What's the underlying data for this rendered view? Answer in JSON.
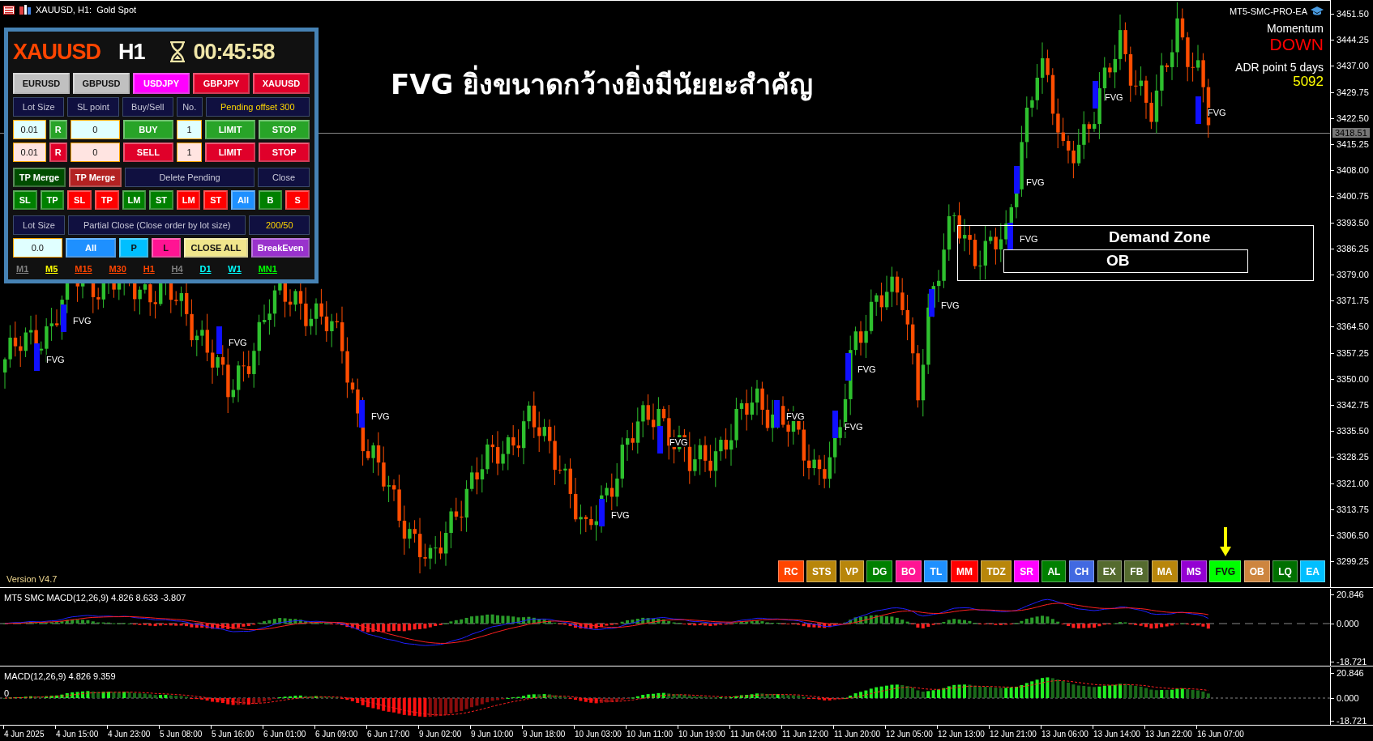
{
  "title_bar": {
    "text": "XAUUSD, H1:  Gold Spot"
  },
  "panel": {
    "symbol": "XAUUSD",
    "timeframe": "H1",
    "countdown": "00:45:58",
    "groups": [
      {
        "items": [
          {
            "kind": "button",
            "text": "EURUSD",
            "color": "#c0c0c0",
            "dark_text": true
          },
          {
            "kind": "button",
            "text": "GBPUSD",
            "color": "#c0c0c0",
            "dark_text": true
          },
          {
            "kind": "button",
            "text": "USDJPY",
            "color": "#ff00ff",
            "dark_text": false
          },
          {
            "kind": "button",
            "text": "GBPJPY",
            "color": "#e0002a",
            "dark_text": false
          },
          {
            "kind": "button",
            "text": "XAUUSD",
            "color": "#e0002a",
            "dark_text": false
          }
        ]
      },
      {
        "items": [
          {
            "kind": "header",
            "text": "Lot Size",
            "highlight": false
          },
          {
            "kind": "header",
            "text": "SL point",
            "highlight": false
          },
          {
            "kind": "header",
            "text": "Buy/Sell",
            "highlight": false
          },
          {
            "kind": "header",
            "text": "No.",
            "highlight": false
          },
          {
            "kind": "header",
            "text": "Pending offset 300",
            "highlight": true
          }
        ]
      },
      {
        "items": [
          {
            "kind": "input",
            "text": "0.01",
            "color": "#e0ffff"
          },
          {
            "kind": "button",
            "text": "R",
            "color": "#28a428",
            "dark_text": false
          },
          {
            "kind": "input",
            "text": "0",
            "color": "#e0ffff"
          },
          {
            "kind": "button",
            "text": "BUY",
            "color": "#28a428",
            "dark_text": false
          },
          {
            "kind": "input",
            "text": "1",
            "color": "#e0ffff"
          },
          {
            "kind": "button",
            "text": "LIMIT",
            "color": "#28a428",
            "dark_text": false
          },
          {
            "kind": "button",
            "text": "STOP",
            "color": "#28a428",
            "dark_text": false
          }
        ]
      },
      {
        "items": [
          {
            "kind": "input",
            "text": "0.01",
            "color": "#ffe4e1"
          },
          {
            "kind": "button",
            "text": "R",
            "color": "#e0002a",
            "dark_text": false
          },
          {
            "kind": "input",
            "text": "0",
            "color": "#ffe4e1"
          },
          {
            "kind": "button",
            "text": "SELL",
            "color": "#e0002a",
            "dark_text": false
          },
          {
            "kind": "input",
            "text": "1",
            "color": "#ffe4e1"
          },
          {
            "kind": "button",
            "text": "LIMIT",
            "color": "#e0002a",
            "dark_text": false
          },
          {
            "kind": "button",
            "text": "STOP",
            "color": "#e0002a",
            "dark_text": false
          }
        ]
      },
      {
        "items": [
          {
            "kind": "button",
            "text": "TP Merge",
            "color": "#004d00",
            "dark_text": false
          },
          {
            "kind": "button",
            "text": "TP Merge",
            "color": "#b22222",
            "dark_text": false
          },
          {
            "kind": "header",
            "text": "Delete Pending",
            "highlight": false
          },
          {
            "kind": "header",
            "text": "Close",
            "highlight": false
          }
        ]
      },
      {
        "items": [
          {
            "kind": "button",
            "text": "SL",
            "color": "#008000",
            "dark_text": false
          },
          {
            "kind": "button",
            "text": "TP",
            "color": "#008000",
            "dark_text": false
          },
          {
            "kind": "button",
            "text": "SL",
            "color": "#ff0000",
            "dark_text": false
          },
          {
            "kind": "button",
            "text": "TP",
            "color": "#ff0000",
            "dark_text": false
          },
          {
            "kind": "button",
            "text": "LM",
            "color": "#008000",
            "dark_text": false
          },
          {
            "kind": "button",
            "text": "ST",
            "color": "#008000",
            "dark_text": false
          },
          {
            "kind": "button",
            "text": "LM",
            "color": "#ff0000",
            "dark_text": false
          },
          {
            "kind": "button",
            "text": "ST",
            "color": "#ff0000",
            "dark_text": false
          },
          {
            "kind": "button",
            "text": "All",
            "color": "#1e90ff",
            "dark_text": false
          },
          {
            "kind": "button",
            "text": "B",
            "color": "#008000",
            "dark_text": false
          },
          {
            "kind": "button",
            "text": "S",
            "color": "#ff0000",
            "dark_text": false
          }
        ]
      },
      {
        "items": [
          {
            "kind": "header",
            "text": "Lot Size",
            "highlight": false
          },
          {
            "kind": "header",
            "text": "Partial Close (Close order by lot size)",
            "highlight": false
          },
          {
            "kind": "header",
            "text": "200/50",
            "highlight": true
          }
        ]
      },
      {
        "items": [
          {
            "kind": "input",
            "text": "0.0",
            "color": "#e0ffff"
          },
          {
            "kind": "button",
            "text": "All",
            "color": "#1e90ff",
            "dark_text": false
          },
          {
            "kind": "button",
            "text": "P",
            "color": "#00bfff",
            "dark_text": true
          },
          {
            "kind": "button",
            "text": "L",
            "color": "#ff1493",
            "dark_text": true
          },
          {
            "kind": "button",
            "text": "CLOSE ALL",
            "color": "#f0e68c",
            "dark_text": true
          },
          {
            "kind": "button",
            "text": "BreakEven",
            "color": "#9932cc",
            "dark_text": false
          }
        ]
      }
    ],
    "timeframes": [
      {
        "label": "M1",
        "color": "#808080"
      },
      {
        "label": "M5",
        "color": "#ffff00"
      },
      {
        "label": "M15",
        "color": "#ff4500"
      },
      {
        "label": "M30",
        "color": "#ff4500"
      },
      {
        "label": "H1",
        "color": "#ff4500"
      },
      {
        "label": "H4",
        "color": "#808080"
      },
      {
        "label": "D1",
        "color": "#00ffff"
      },
      {
        "label": "W1",
        "color": "#00ffff"
      },
      {
        "label": "MN1",
        "color": "#00ff00"
      }
    ]
  },
  "chart": {
    "headline": "FVG ยิ่งขนาดกว้างยิ่งมีนัยยะสำคัญ",
    "ea_name": "MT5-SMC-PRO-EA",
    "momentum_label": "Momentum",
    "momentum_value": "DOWN",
    "adr_label": "ADR point 5 days",
    "adr_value": "5092",
    "version": "Version V4.7",
    "fvg_labels": [
      "FVG",
      "FVG",
      "FVG",
      "FVG",
      "FVG",
      "FVG",
      "FVG",
      "FVG",
      "FVG",
      "FVG",
      "FVG",
      "FVG",
      "FVG",
      "FVG"
    ],
    "zones": [
      {
        "label": "Demand Zone"
      },
      {
        "label": "OB"
      }
    ],
    "price_ticks": [
      "3451.50",
      "3444.25",
      "3437.00",
      "3429.75",
      "3422.50",
      "3415.25",
      "3408.00",
      "3400.75",
      "3393.50",
      "3386.25",
      "3379.00",
      "3371.75",
      "3364.50",
      "3357.25",
      "3350.00",
      "3342.75",
      "3335.50",
      "3328.25",
      "3321.00",
      "3313.75",
      "3306.50",
      "3299.25"
    ],
    "current_price": "3418.51"
  },
  "toolbar": [
    {
      "label": "RC",
      "color": "#ff4500",
      "marked": false
    },
    {
      "label": "STS",
      "color": "#b8860b",
      "marked": false
    },
    {
      "label": "VP",
      "color": "#b8860b",
      "marked": false
    },
    {
      "label": "DG",
      "color": "#008000",
      "marked": false
    },
    {
      "label": "BO",
      "color": "#ff1493",
      "marked": false
    },
    {
      "label": "TL",
      "color": "#1e90ff",
      "marked": false
    },
    {
      "label": "MM",
      "color": "#ff0000",
      "marked": false
    },
    {
      "label": "TDZ",
      "color": "#b8860b",
      "marked": false
    },
    {
      "label": "SR",
      "color": "#ff00ff",
      "marked": false
    },
    {
      "label": "AL",
      "color": "#008000",
      "marked": false
    },
    {
      "label": "CH",
      "color": "#4169e1",
      "marked": false
    },
    {
      "label": "EX",
      "color": "#556b2f",
      "marked": false
    },
    {
      "label": "FB",
      "color": "#556b2f",
      "marked": false
    },
    {
      "label": "MA",
      "color": "#b8860b",
      "marked": false
    },
    {
      "label": "MS",
      "color": "#9400d3",
      "marked": false
    },
    {
      "label": "FVG",
      "color": "#00ff00",
      "marked": true
    },
    {
      "label": "OB",
      "color": "#cd853f",
      "marked": false
    },
    {
      "label": "LQ",
      "color": "#007000",
      "marked": false
    },
    {
      "label": "EA",
      "color": "#00bfff",
      "marked": false
    }
  ],
  "macd_panes": [
    {
      "label": "MT5 SMC MACD(12,26,9) 4.826 8.633 -3.807",
      "ticks": [
        "20.846",
        "0.000",
        "-18.721"
      ]
    },
    {
      "label": "MACD(12,26,9) 4.826 9.359",
      "zero_label": "0",
      "ticks": [
        "20.846",
        "0.000",
        "-18.721"
      ]
    }
  ],
  "time_labels": [
    "4 Jun 2025",
    "4 Jun 15:00",
    "4 Jun 23:00",
    "5 Jun 08:00",
    "5 Jun 16:00",
    "6 Jun 01:00",
    "6 Jun 09:00",
    "6 Jun 17:00",
    "9 Jun 02:00",
    "9 Jun 10:00",
    "9 Jun 18:00",
    "10 Jun 03:00",
    "10 Jun 11:00",
    "10 Jun 19:00",
    "11 Jun 04:00",
    "11 Jun 12:00",
    "11 Jun 20:00",
    "12 Jun 05:00",
    "12 Jun 13:00",
    "12 Jun 21:00",
    "13 Jun 06:00",
    "13 Jun 14:00",
    "13 Jun 22:00",
    "16 Jun 07:00"
  ]
}
